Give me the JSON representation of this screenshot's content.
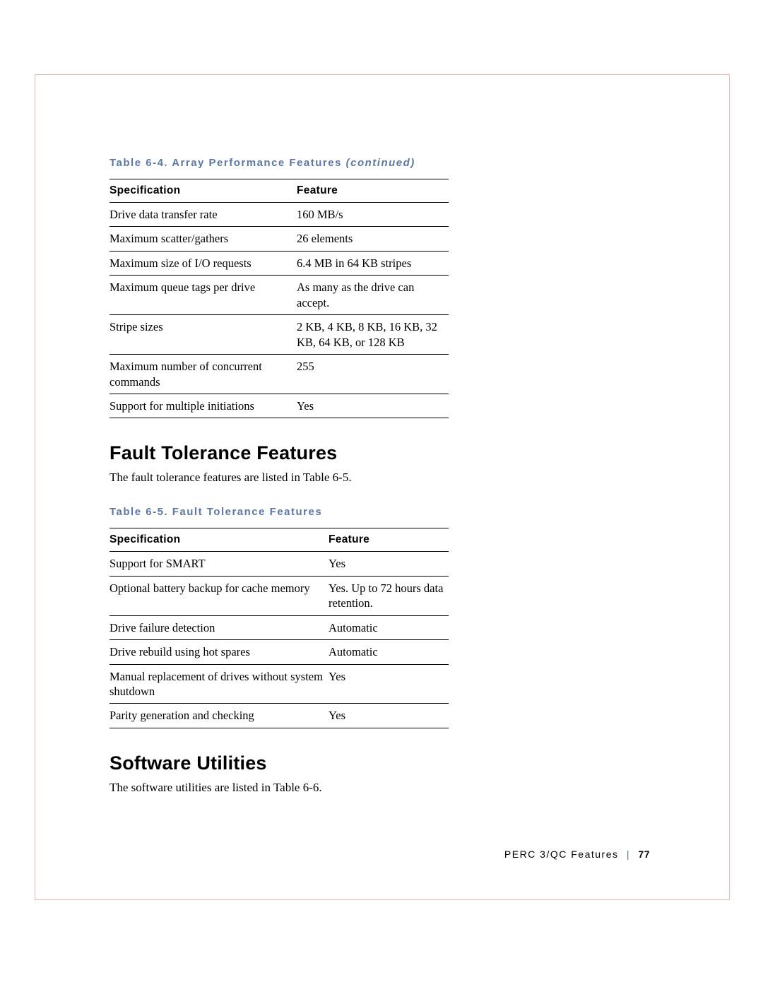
{
  "table64": {
    "caption_prefix": "Table 6-4. Array Performance Features ",
    "caption_suffix": "(continued)",
    "col1": "Specification",
    "col2": "Feature",
    "rows": [
      {
        "spec": "Drive data transfer rate",
        "feat": "160 MB/s"
      },
      {
        "spec": "Maximum scatter/gathers",
        "feat": "26 elements"
      },
      {
        "spec": "Maximum size of I/O requests",
        "feat": "6.4 MB in 64 KB stripes"
      },
      {
        "spec": "Maximum queue tags per drive",
        "feat": "As many as the drive can accept."
      },
      {
        "spec": "Stripe sizes",
        "feat": "2 KB, 4 KB, 8 KB, 16 KB, 32 KB, 64 KB, or 128 KB"
      },
      {
        "spec": "Maximum number of concurrent commands",
        "feat": "255"
      },
      {
        "spec": "Support for multiple initiations",
        "feat": "Yes"
      }
    ]
  },
  "section_fault": {
    "heading": "Fault Tolerance Features",
    "body": "The fault tolerance features are listed in Table 6-5."
  },
  "table65": {
    "caption": "Table 6-5. Fault Tolerance Features",
    "col1": "Specification",
    "col2": "Feature",
    "rows": [
      {
        "spec": "Support for SMART",
        "feat": "Yes"
      },
      {
        "spec": "Optional battery backup for cache memory",
        "feat": "Yes. Up to 72 hours data retention."
      },
      {
        "spec": "Drive failure detection",
        "feat": "Automatic"
      },
      {
        "spec": "Drive rebuild using hot spares",
        "feat": "Automatic"
      },
      {
        "spec": "Manual replacement of drives without system shutdown",
        "feat": "Yes"
      },
      {
        "spec": "Parity generation and checking",
        "feat": "Yes"
      }
    ]
  },
  "section_soft": {
    "heading": "Software Utilities",
    "body": "The software utilities are listed in Table 6-6."
  },
  "footer": {
    "label": "PERC 3/QC Features",
    "page": "77"
  }
}
